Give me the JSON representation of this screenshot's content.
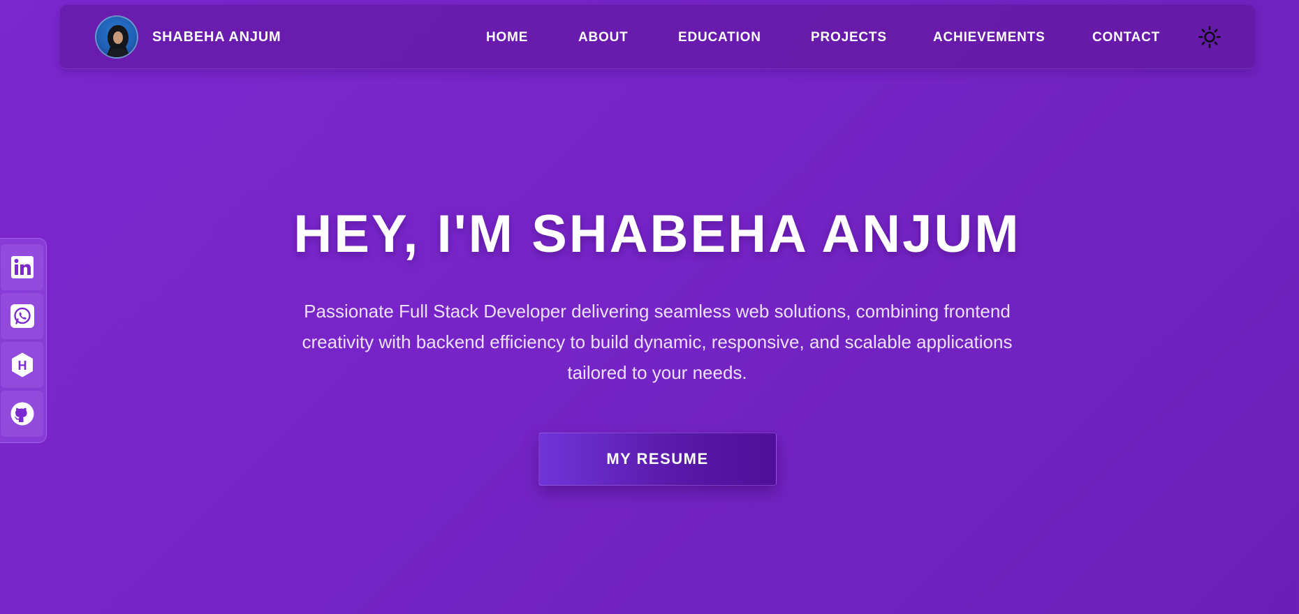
{
  "brand": {
    "name": "SHABEHA ANJUM",
    "avatar_icon": "profile-photo"
  },
  "nav": {
    "links": [
      "HOME",
      "ABOUT",
      "EDUCATION",
      "PROJECTS",
      "ACHIEVEMENTS",
      "CONTACT"
    ],
    "theme_toggle_icon": "sun-icon"
  },
  "social": [
    "linkedin-icon",
    "whatsapp-icon",
    "hashnode-icon",
    "github-icon"
  ],
  "hero": {
    "title": "HEY, I'M SHABEHA ANJUM",
    "description": "Passionate Full Stack Developer delivering seamless web solutions, combining frontend creativity with backend efficiency to build dynamic, responsive, and scalable applications tailored to your needs.",
    "button_label": "MY RESUME"
  },
  "colors": {
    "background": "#7624c6",
    "navbar": "#5c1496",
    "button": "#5a1aaa",
    "text": "#ffffff"
  }
}
